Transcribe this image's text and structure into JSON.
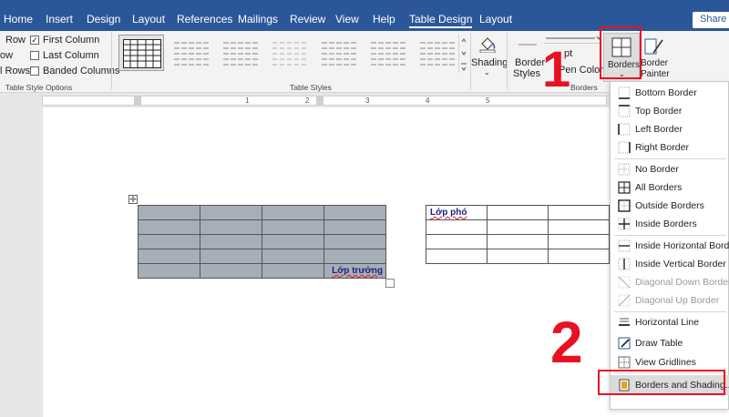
{
  "tabs": [
    {
      "label": "Home"
    },
    {
      "label": "Insert"
    },
    {
      "label": "Design"
    },
    {
      "label": "Layout"
    },
    {
      "label": "References"
    },
    {
      "label": "Mailings"
    },
    {
      "label": "Review"
    },
    {
      "label": "View"
    },
    {
      "label": "Help"
    },
    {
      "label": "Table Design"
    },
    {
      "label": "Layout"
    }
  ],
  "share_label": "Share",
  "style_options": {
    "header_row": "Row",
    "first_column": "First Column",
    "total_row": "ow",
    "last_column": "Last Column",
    "banded_rows": "l Rows",
    "banded_columns": "Banded Columns",
    "group_label": "Table Style Options"
  },
  "table_styles_label": "Table Styles",
  "shading_label": "Shading",
  "borders_group": {
    "border_styles_line1": "Border",
    "border_styles_line2": "Styles",
    "pen_weight": "pt",
    "pen_color": "Pen Color",
    "borders_button": "Borders",
    "border_painter_line1": "Border",
    "border_painter_line2": "Painter",
    "group_label": "Borders"
  },
  "ruler_numbers": [
    "1",
    "2",
    "3",
    "4",
    "5"
  ],
  "document": {
    "cell_text_left": "Lớp trưởng",
    "cell_text_right": "Lớp phó"
  },
  "menu_items": [
    {
      "label": "Bottom Border",
      "icon": "bottom-border-icon",
      "enabled": true
    },
    {
      "label": "Top Border",
      "icon": "top-border-icon",
      "enabled": true
    },
    {
      "label": "Left Border",
      "icon": "left-border-icon",
      "enabled": true
    },
    {
      "label": "Right Border",
      "icon": "right-border-icon",
      "enabled": true
    },
    {
      "label": "No Border",
      "icon": "no-border-icon",
      "enabled": true
    },
    {
      "label": "All Borders",
      "icon": "all-borders-icon",
      "enabled": true
    },
    {
      "label": "Outside Borders",
      "icon": "outside-borders-icon",
      "enabled": true
    },
    {
      "label": "Inside Borders",
      "icon": "inside-borders-icon",
      "enabled": true
    },
    {
      "label": "Inside Horizontal Border",
      "icon": "inside-horizontal-border-icon",
      "enabled": true
    },
    {
      "label": "Inside Vertical Border",
      "icon": "inside-vertical-border-icon",
      "enabled": true
    },
    {
      "label": "Diagonal Down Border",
      "icon": "diagonal-down-border-icon",
      "enabled": false
    },
    {
      "label": "Diagonal Up Border",
      "icon": "diagonal-up-border-icon",
      "enabled": false
    },
    {
      "label": "Horizontal Line",
      "icon": "horizontal-line-icon",
      "enabled": true
    },
    {
      "label": "Draw Table",
      "icon": "draw-table-icon",
      "enabled": true
    },
    {
      "label": "View Gridlines",
      "icon": "view-gridlines-icon",
      "enabled": true
    },
    {
      "label": "Borders and Shading...",
      "icon": "borders-and-shading-icon",
      "enabled": true
    }
  ],
  "annotations": {
    "step1": "1",
    "step2": "2"
  },
  "colors": {
    "ribbon_blue": "#2b579a",
    "highlight_red": "#e81123",
    "table_shading": "#a6aeb9"
  }
}
